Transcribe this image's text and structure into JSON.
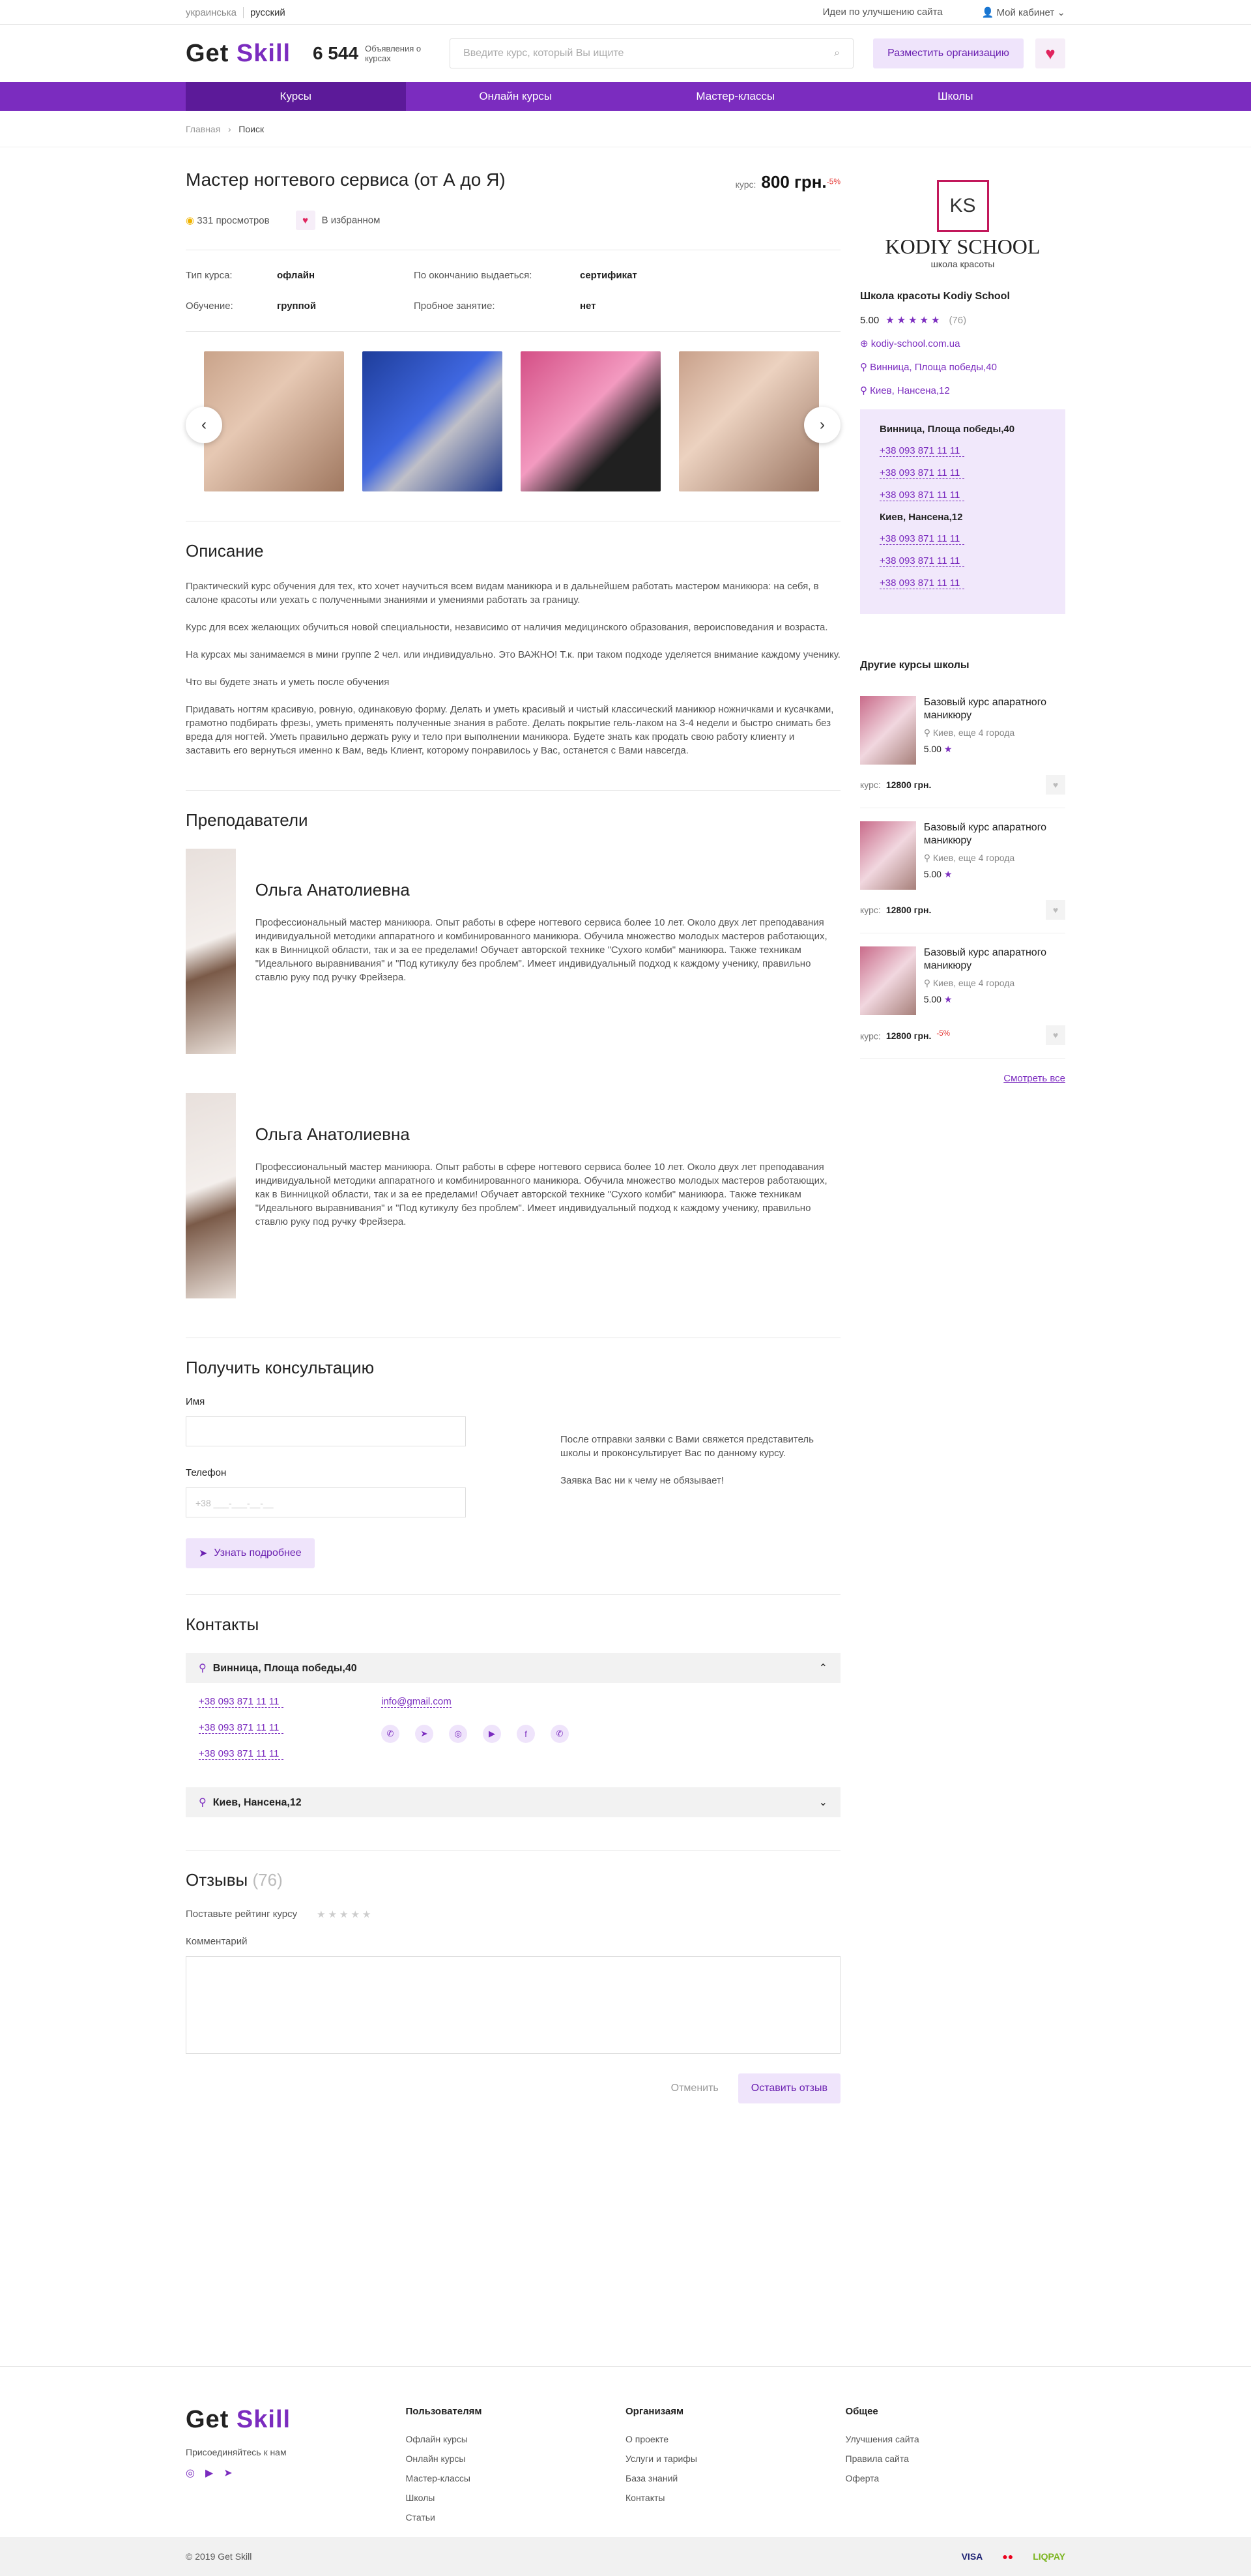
{
  "topbar": {
    "lang1": "украинська",
    "lang2": "русский",
    "ideas": "Идеи по улучшению сайта",
    "cabinet": "Мой кабинет"
  },
  "header": {
    "logo_a": "Get ",
    "logo_b": "Skill",
    "count": "6 544",
    "count_label": "Объявления о курсах",
    "search_placeholder": "Введите курс, который Вы ищите",
    "post": "Разместить организацию"
  },
  "nav": [
    "Курсы",
    "Онлайн курсы",
    "Мастер-классы",
    "Школы"
  ],
  "crumbs": {
    "home": "Главная",
    "current": "Поиск"
  },
  "course": {
    "title": "Мастер ногтевого сервиса (от А до Я)",
    "price_label": "курс:",
    "price": "800 грн.",
    "discount": "-5%",
    "views": "331 просмотров",
    "favorite": "В избранном",
    "props": [
      [
        "Тип курса:",
        "офлайн",
        "По окончанию выдаеться:",
        "сертификат"
      ],
      [
        "Обучение:",
        "группой",
        "Пробное занятие:",
        "нет"
      ]
    ]
  },
  "description": {
    "title": "Описание",
    "paras": [
      "Практический курс обучения для тех, кто хочет научиться всем видам маникюра и в дальнейшем работать мастером маникюра: на себя, в салоне красоты или уехать с полученными знаниями и умениями работать за границу.",
      "Курс для всех желающих обучиться новой специальности, независимо от наличия медицинского образования, вероисповедания и возраста.",
      "На курсах мы занимаемся в мини группе 2 чел. или индивидуально. Это ВАЖНО! Т.к. при таком подходе уделяется внимание каждому ученику.",
      "Что вы будете знать и уметь после обучения",
      "Придавать ногтям красивую, ровную, одинаковую форму. Делать и уметь красивый и чистый классический маникюр ножничками и кусачками, грамотно подбирать фрезы, уметь применять полученные знания в работе. Делать покрытие гель-лаком на 3-4 недели и быстро снимать без вреда для ногтей. Уметь правильно держать руку и тело при выполнении маникюра. Будете знать как продать свою работу клиенту и заставить его вернуться именно к Вам, ведь Клиент, которому понравилось у Вас, останется с Вами навсегда."
    ]
  },
  "teachers": {
    "title": "Преподаватели",
    "list": [
      {
        "name": "Ольга Анатолиевна",
        "bio": "Профессиональный мастер маникюра. Опыт работы в сфере ногтевого сервиса более 10 лет. Около двух лет преподавания индивидуальной методики аппаратного и комбинированного маникюра. Обучила множество молодых мастеров работающих, как в Винницкой области, так и за ее пределами! Обучает авторской технике \"Сухого комби\" маникюра. Также техникам \"Идеального выравнивания\" и \"Под кутикулу без проблем\". Имеет индивидуальный подход к каждому ученику, правильно ставлю руку под ручку Фрейзера."
      },
      {
        "name": "Ольга Анатолиевна",
        "bio": "Профессиональный мастер маникюра. Опыт работы в сфере ногтевого сервиса более 10 лет. Около двух лет преподавания индивидуальной методики аппаратного и комбинированного маникюра. Обучила множество молодых мастеров работающих, как в Винницкой области, так и за ее пределами! Обучает авторской технике \"Сухого комби\" маникюра. Также техникам \"Идеального выравнивания\" и \"Под кутикулу без проблем\". Имеет индивидуальный подход к каждому ученику, правильно ставлю руку под ручку Фрейзера."
      }
    ]
  },
  "consult": {
    "title": "Получить консультацию",
    "name_label": "Имя",
    "phone_label": "Телефон",
    "phone_placeholder": "+38 ___-___-__-__",
    "button": "Узнать подробнее",
    "note1": "После отправки заявки с Вами свяжется представитель школы и проконсультирует Вас по данному курсу.",
    "note2": "Заявка Вас ни к чему не обязывает!"
  },
  "contacts": {
    "title": "Контакты",
    "addr1": "Винница, Площа победы,40",
    "addr2": "Киев, Нансена,12",
    "phones": [
      "+38 093 871 11 11",
      "+38 093 871 11 11",
      "+38 093 871 11 11"
    ],
    "email": "info@gmail.com"
  },
  "reviews": {
    "title": "Отзывы",
    "count": "(76)",
    "rate_label": "Поставьте рейтинг курсу",
    "comment_label": "Комментарий",
    "cancel": "Отменить",
    "submit": "Оставить отзыв"
  },
  "school": {
    "mono": "KS",
    "name": "KODIY SCHOOL",
    "sub": "школа красоты",
    "title": "Школа красоты Kodiy School",
    "rating": "5.00",
    "reviews": "(76)",
    "site": "kodiy-school.com.ua",
    "addr1": "Винница, Площа победы,40",
    "addr2": "Киев, Нансена,12",
    "box": [
      {
        "addr": "Винница, Площа победы,40",
        "phones": [
          "+38 093 871 11 11",
          "+38 093 871 11 11",
          "+38 093 871 11 11"
        ]
      },
      {
        "addr": "Киев, Нансена,12",
        "phones": [
          "+38 093 871 11 11",
          "+38 093 871 11 11",
          "+38 093 871 11 11"
        ]
      }
    ]
  },
  "other": {
    "title": "Другие курсы школы",
    "see_all": "Смотреть все",
    "items": [
      {
        "name": "Базовый курс апаратного маникюру",
        "city": "Киев,",
        "more": "еще 4 города",
        "rating": "5.00",
        "price_label": "курс:",
        "price": "12800 грн.",
        "discount": ""
      },
      {
        "name": "Базовый курс апаратного маникюру",
        "city": "Киев,",
        "more": "еще 4 города",
        "rating": "5.00",
        "price_label": "курс:",
        "price": "12800 грн.",
        "discount": ""
      },
      {
        "name": "Базовый курс апаратного маникюру",
        "city": "Киев,",
        "more": "еще 4 города",
        "rating": "5.00",
        "price_label": "курс:",
        "price": "12800 грн.",
        "discount": "-5%"
      }
    ]
  },
  "footer": {
    "join": "Присоединяйтесь к нам",
    "copyright": "© 2019 Get Skill",
    "cols": [
      {
        "title": "Пользователям",
        "links": [
          "Офлайн курсы",
          "Онлайн курсы",
          "Мастер-классы",
          "Школы",
          "Статьи"
        ]
      },
      {
        "title": "Организаям",
        "links": [
          "О проекте",
          "Услуги и тарифы",
          "База знаний",
          "Контакты"
        ]
      },
      {
        "title": "Общее",
        "links": [
          "Улучшения сайта",
          "Правила сайта",
          "Оферта"
        ]
      }
    ],
    "pay": [
      "VISA",
      "●●",
      "LIQPAY"
    ]
  }
}
